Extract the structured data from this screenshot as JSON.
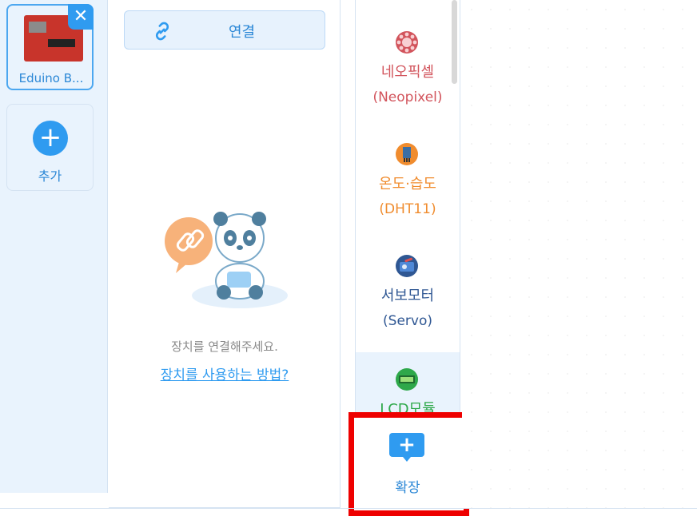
{
  "devices": {
    "current": {
      "name": "Eduino B...",
      "close_icon": "close-icon"
    },
    "add_label": "추가"
  },
  "connect": {
    "button_label": "연결",
    "empty_message": "장치를 연결해주세요.",
    "help_link": "장치를 사용하는 방법?"
  },
  "extensions": {
    "items": [
      {
        "name": "네오픽셀",
        "sub": "(Neopixel)",
        "color": "#d2545c",
        "icon": "neopixel-icon"
      },
      {
        "name": "온도·습도",
        "sub": "(DHT11)",
        "color": "#f08c2e",
        "icon": "dht11-icon"
      },
      {
        "name": "서보모터",
        "sub": "(Servo)",
        "color": "#2f5793",
        "icon": "servo-icon"
      },
      {
        "name": "LCD모듈",
        "sub": "",
        "color": "#2ea84a",
        "icon": "lcd-icon"
      }
    ],
    "extend_label": "확장"
  },
  "colors": {
    "accent": "#2f9bf0",
    "highlight": "#ee0000",
    "panel_bg": "#e9f3fd"
  }
}
